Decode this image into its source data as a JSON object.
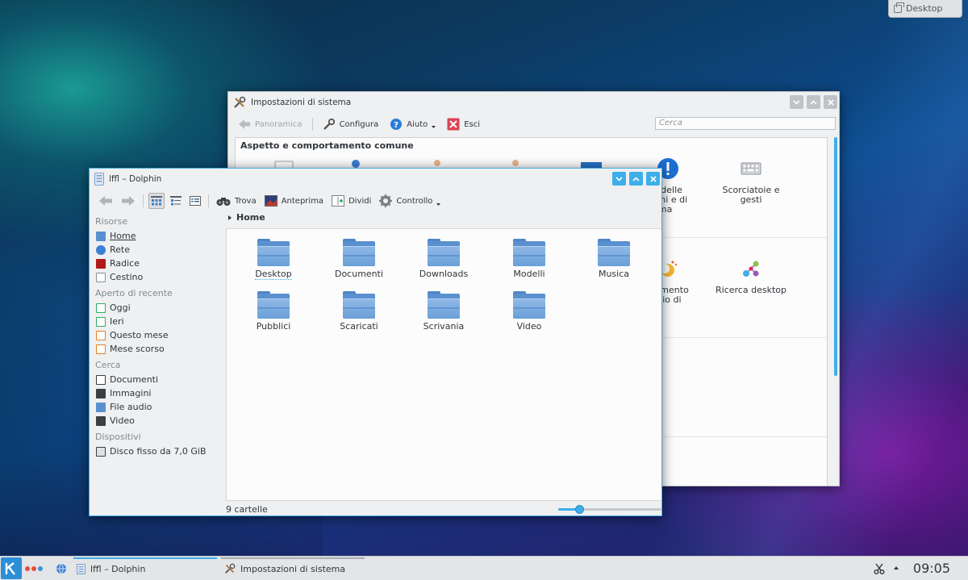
{
  "desktop": {
    "toolbox_label": "Desktop"
  },
  "settings": {
    "title": "Impostazioni di sistema",
    "toolbar": {
      "overview": "Panoramica",
      "configure": "Configura",
      "help": "Aiuto",
      "quit": "Esci"
    },
    "search_placeholder": "Cerca",
    "section_heading": "Aspetto e comportamento comune",
    "items": [
      {
        "label": "che delle\nazioni e di\nistema"
      },
      {
        "label": "Scorciatoie e\ngesti"
      },
      {
        "label": "ortamento\nspazio di\nvoro"
      },
      {
        "label": "Ricerca desktop"
      }
    ]
  },
  "dolphin": {
    "title": "lffl – Dolphin",
    "toolbar": {
      "find": "Trova",
      "preview": "Anteprima",
      "split": "Dividi",
      "control": "Controllo"
    },
    "breadcrumb": "Home",
    "places": {
      "sections": [
        {
          "title": "Risorse",
          "items": [
            "Home",
            "Rete",
            "Radice",
            "Cestino"
          ]
        },
        {
          "title": "Aperto di recente",
          "items": [
            "Oggi",
            "Ieri",
            "Questo mese",
            "Mese scorso"
          ]
        },
        {
          "title": "Cerca",
          "items": [
            "Documenti",
            "Immagini",
            "File audio",
            "Video"
          ]
        },
        {
          "title": "Dispositivi",
          "items": [
            "Disco fisso da 7,0 GiB"
          ]
        }
      ]
    },
    "folders": [
      "Desktop",
      "Documenti",
      "Downloads",
      "Modelli",
      "Musica",
      "Pubblici",
      "Scaricati",
      "Scrivania",
      "Video"
    ],
    "status_text": "9 cartelle",
    "zoom_level_fraction": 0.2
  },
  "taskbar": {
    "tasks": [
      {
        "label": "lffl – Dolphin"
      },
      {
        "label": "Impostazioni di sistema"
      }
    ],
    "clock": "09:05"
  },
  "colors": {
    "accent": "#3daee9",
    "window_bg": "#eff0f1",
    "view_bg": "#fcfcfc"
  }
}
